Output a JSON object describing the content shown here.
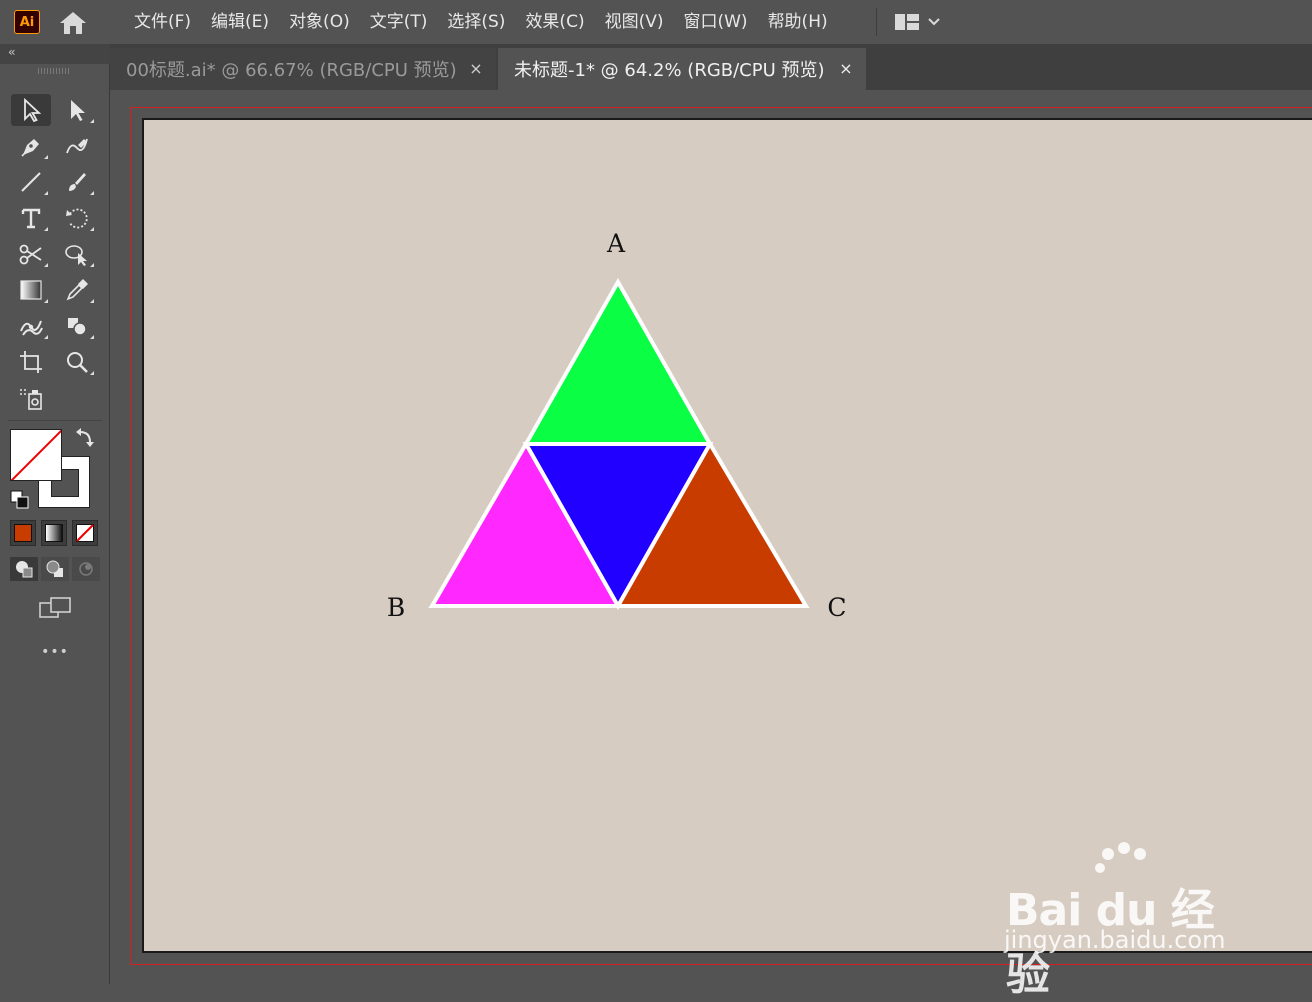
{
  "app": {
    "logo": "Ai",
    "home_icon": "home-icon"
  },
  "menu": [
    "文件(F)",
    "编辑(E)",
    "对象(O)",
    "文字(T)",
    "选择(S)",
    "效果(C)",
    "视图(V)",
    "窗口(W)",
    "帮助(H)"
  ],
  "workspace_switcher": {
    "icon": "layout-grid-icon",
    "caret": "chevron-down-icon"
  },
  "toolpanel": {
    "collapse": "‹‹",
    "tools": [
      "selection-tool",
      "direct-selection-tool",
      "pen-tool",
      "curvature-tool",
      "line-segment-tool",
      "paintbrush-tool",
      "type-tool",
      "rotate-tool",
      "scissors-tool",
      "shape-builder-tool",
      "gradient-tool",
      "eyedropper-tool",
      "puppet-warp-tool",
      "shaper-tool",
      "artboard-tool",
      "zoom-tool",
      "symbol-sprayer-tool"
    ],
    "fill": "none",
    "stroke": "#ffffff",
    "color_modes": [
      "#c83c00",
      "gradient",
      "none"
    ],
    "more_label": "•••"
  },
  "tabs": [
    {
      "label": "00标题.ai* @ 66.67% (RGB/CPU 预览)",
      "active": false,
      "close": "×"
    },
    {
      "label": "未标题-1* @ 64.2% (RGB/CPU 预览)",
      "active": true,
      "close": "×"
    }
  ],
  "artwork": {
    "labels": {
      "a": "A",
      "b": "B",
      "c": "C"
    },
    "colors": {
      "top": "#0afe44",
      "middle": "#2200ff",
      "left": "#ff29ff",
      "right": "#c93c00",
      "stroke": "#ffffff",
      "artboard": "#d6ccc2"
    }
  },
  "watermark": {
    "brand": "Bai du 经验",
    "url": "jingyan.baidu.com"
  }
}
